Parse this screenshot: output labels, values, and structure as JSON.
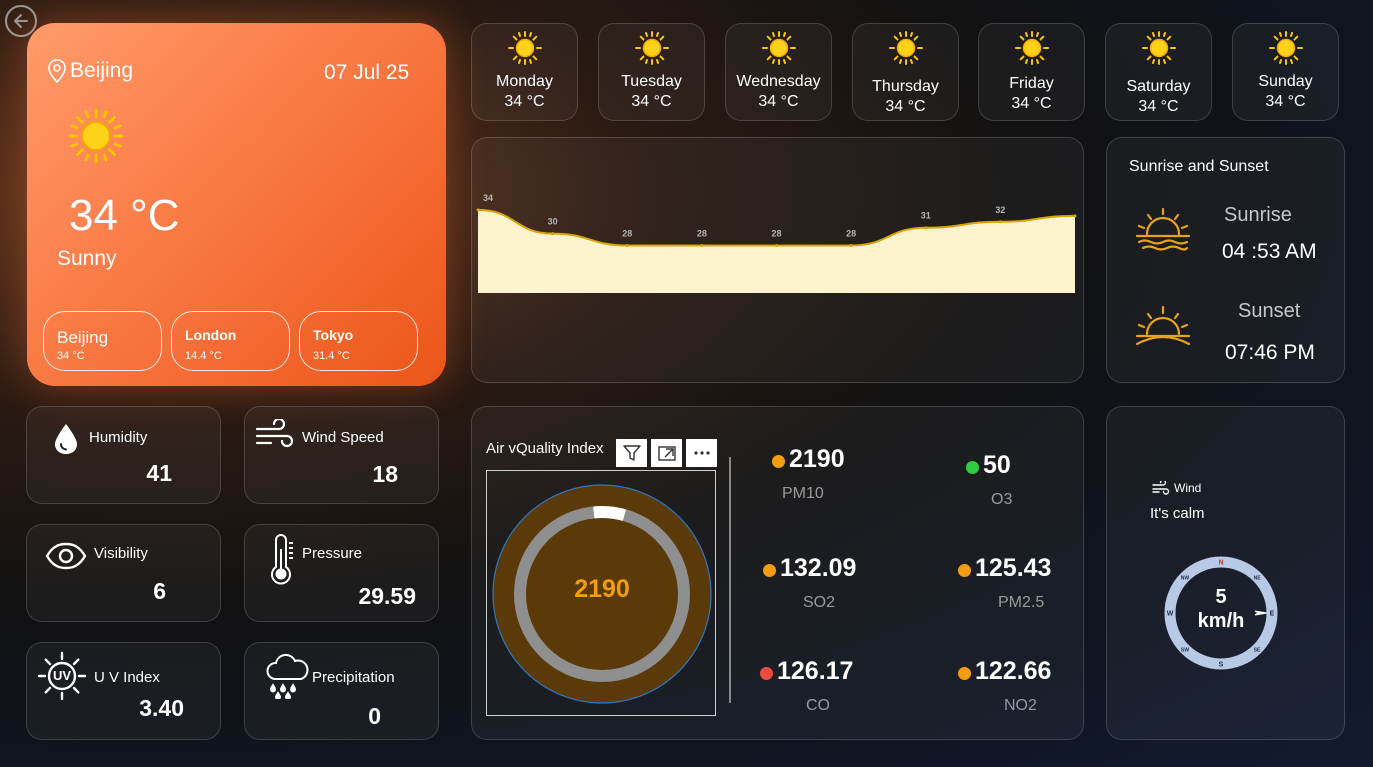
{
  "hero": {
    "city": "Beijing",
    "date": "07 Jul 25",
    "temperature": "34 °C",
    "condition": "Sunny",
    "cities": [
      {
        "name": "Beijing",
        "temp": "34 °C"
      },
      {
        "name": "London",
        "temp": "14.4 °C"
      },
      {
        "name": "Tokyo",
        "temp": "31.4 °C"
      }
    ]
  },
  "forecast": [
    {
      "day": "Monday",
      "temp": "34 °C"
    },
    {
      "day": "Tuesday",
      "temp": "34 °C"
    },
    {
      "day": "Wednesday",
      "temp": "34 °C"
    },
    {
      "day": "Thursday",
      "temp": "34 °C"
    },
    {
      "day": "Friday",
      "temp": "34 °C"
    },
    {
      "day": "Saturday",
      "temp": "34 °C"
    },
    {
      "day": "Sunday",
      "temp": "34 °C"
    }
  ],
  "chart_data": {
    "type": "area",
    "x": [
      0,
      1,
      2,
      3,
      4,
      5,
      6,
      7,
      8
    ],
    "values": [
      34,
      30,
      28,
      28,
      28,
      28,
      31,
      32,
      33
    ],
    "data_labels": [
      "34",
      "30",
      "28",
      "28",
      "28",
      "28",
      "31",
      "32",
      ""
    ],
    "ylim": [
      20,
      36
    ],
    "fill_color": "#fdf3cf",
    "line_color": "#d9a400",
    "grid": false
  },
  "sun_times": {
    "title": "Sunrise and Sunset",
    "sunrise_label": "Sunrise",
    "sunrise_time": "04 :53 AM",
    "sunset_label": "Sunset",
    "sunset_time": "07:46 PM"
  },
  "stats": {
    "humidity": {
      "label": "Humidity",
      "value": "41"
    },
    "wind_speed": {
      "label": "Wind Speed",
      "value": "18"
    },
    "visibility": {
      "label": "Visibility",
      "value": "6"
    },
    "pressure": {
      "label": "Pressure",
      "value": "29.59"
    },
    "uv_index": {
      "label": "U V Index",
      "value": "3.40",
      "icon_text": "UV"
    },
    "precipitation": {
      "label": "Precipitation",
      "value": "0"
    }
  },
  "aqi": {
    "title": "Air vQuality Index",
    "value": "2190",
    "gauge_fill": 0.06,
    "gauge_bg": "#5a3a08",
    "pollutants": [
      {
        "label": "PM10",
        "value": "2190",
        "color": "#f39c12"
      },
      {
        "label": "O3",
        "value": "50",
        "color": "#2ecc40"
      },
      {
        "label": "SO2",
        "value": "132.09",
        "color": "#f39c12"
      },
      {
        "label": "PM2.5",
        "value": "125.43",
        "color": "#f39c12"
      },
      {
        "label": "CO",
        "value": "126.17",
        "color": "#e74c3c"
      },
      {
        "label": "NO2",
        "value": "122.66",
        "color": "#f39c12"
      }
    ]
  },
  "wind": {
    "label": "Wind",
    "status": "It's calm",
    "speed": "5",
    "unit": "km/h",
    "compass_letters": [
      "N",
      "NE",
      "E",
      "SE",
      "S",
      "SW",
      "W",
      "NW"
    ]
  },
  "colors": {
    "accent": "#fa7a45",
    "sun": "#ffc400",
    "sun_line": "#e8a317"
  }
}
